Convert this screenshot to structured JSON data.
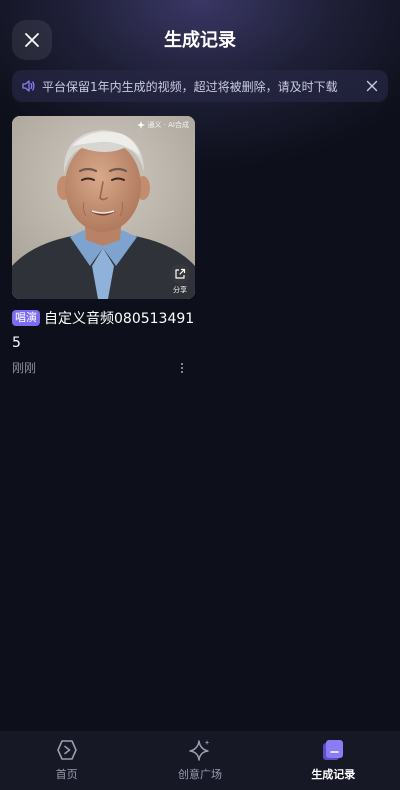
{
  "header": {
    "title": "生成记录"
  },
  "notice": {
    "text": "平台保留1年内生成的视频，超过将被删除，请及时下载"
  },
  "records": [
    {
      "badge": "唱演",
      "title": "自定义音频0805134915",
      "time": "刚刚",
      "watermark": "通义 · AI合成",
      "share_label": "分享"
    }
  ],
  "tabbar": {
    "items": [
      {
        "label": "首页",
        "icon": "home-play-icon",
        "active": false
      },
      {
        "label": "创意广场",
        "icon": "sparkle-icon",
        "active": false
      },
      {
        "label": "生成记录",
        "icon": "records-icon",
        "active": true
      }
    ]
  },
  "colors": {
    "accent": "#7c6cf0",
    "background": "#0d0f1a",
    "tabbar": "#161826"
  }
}
